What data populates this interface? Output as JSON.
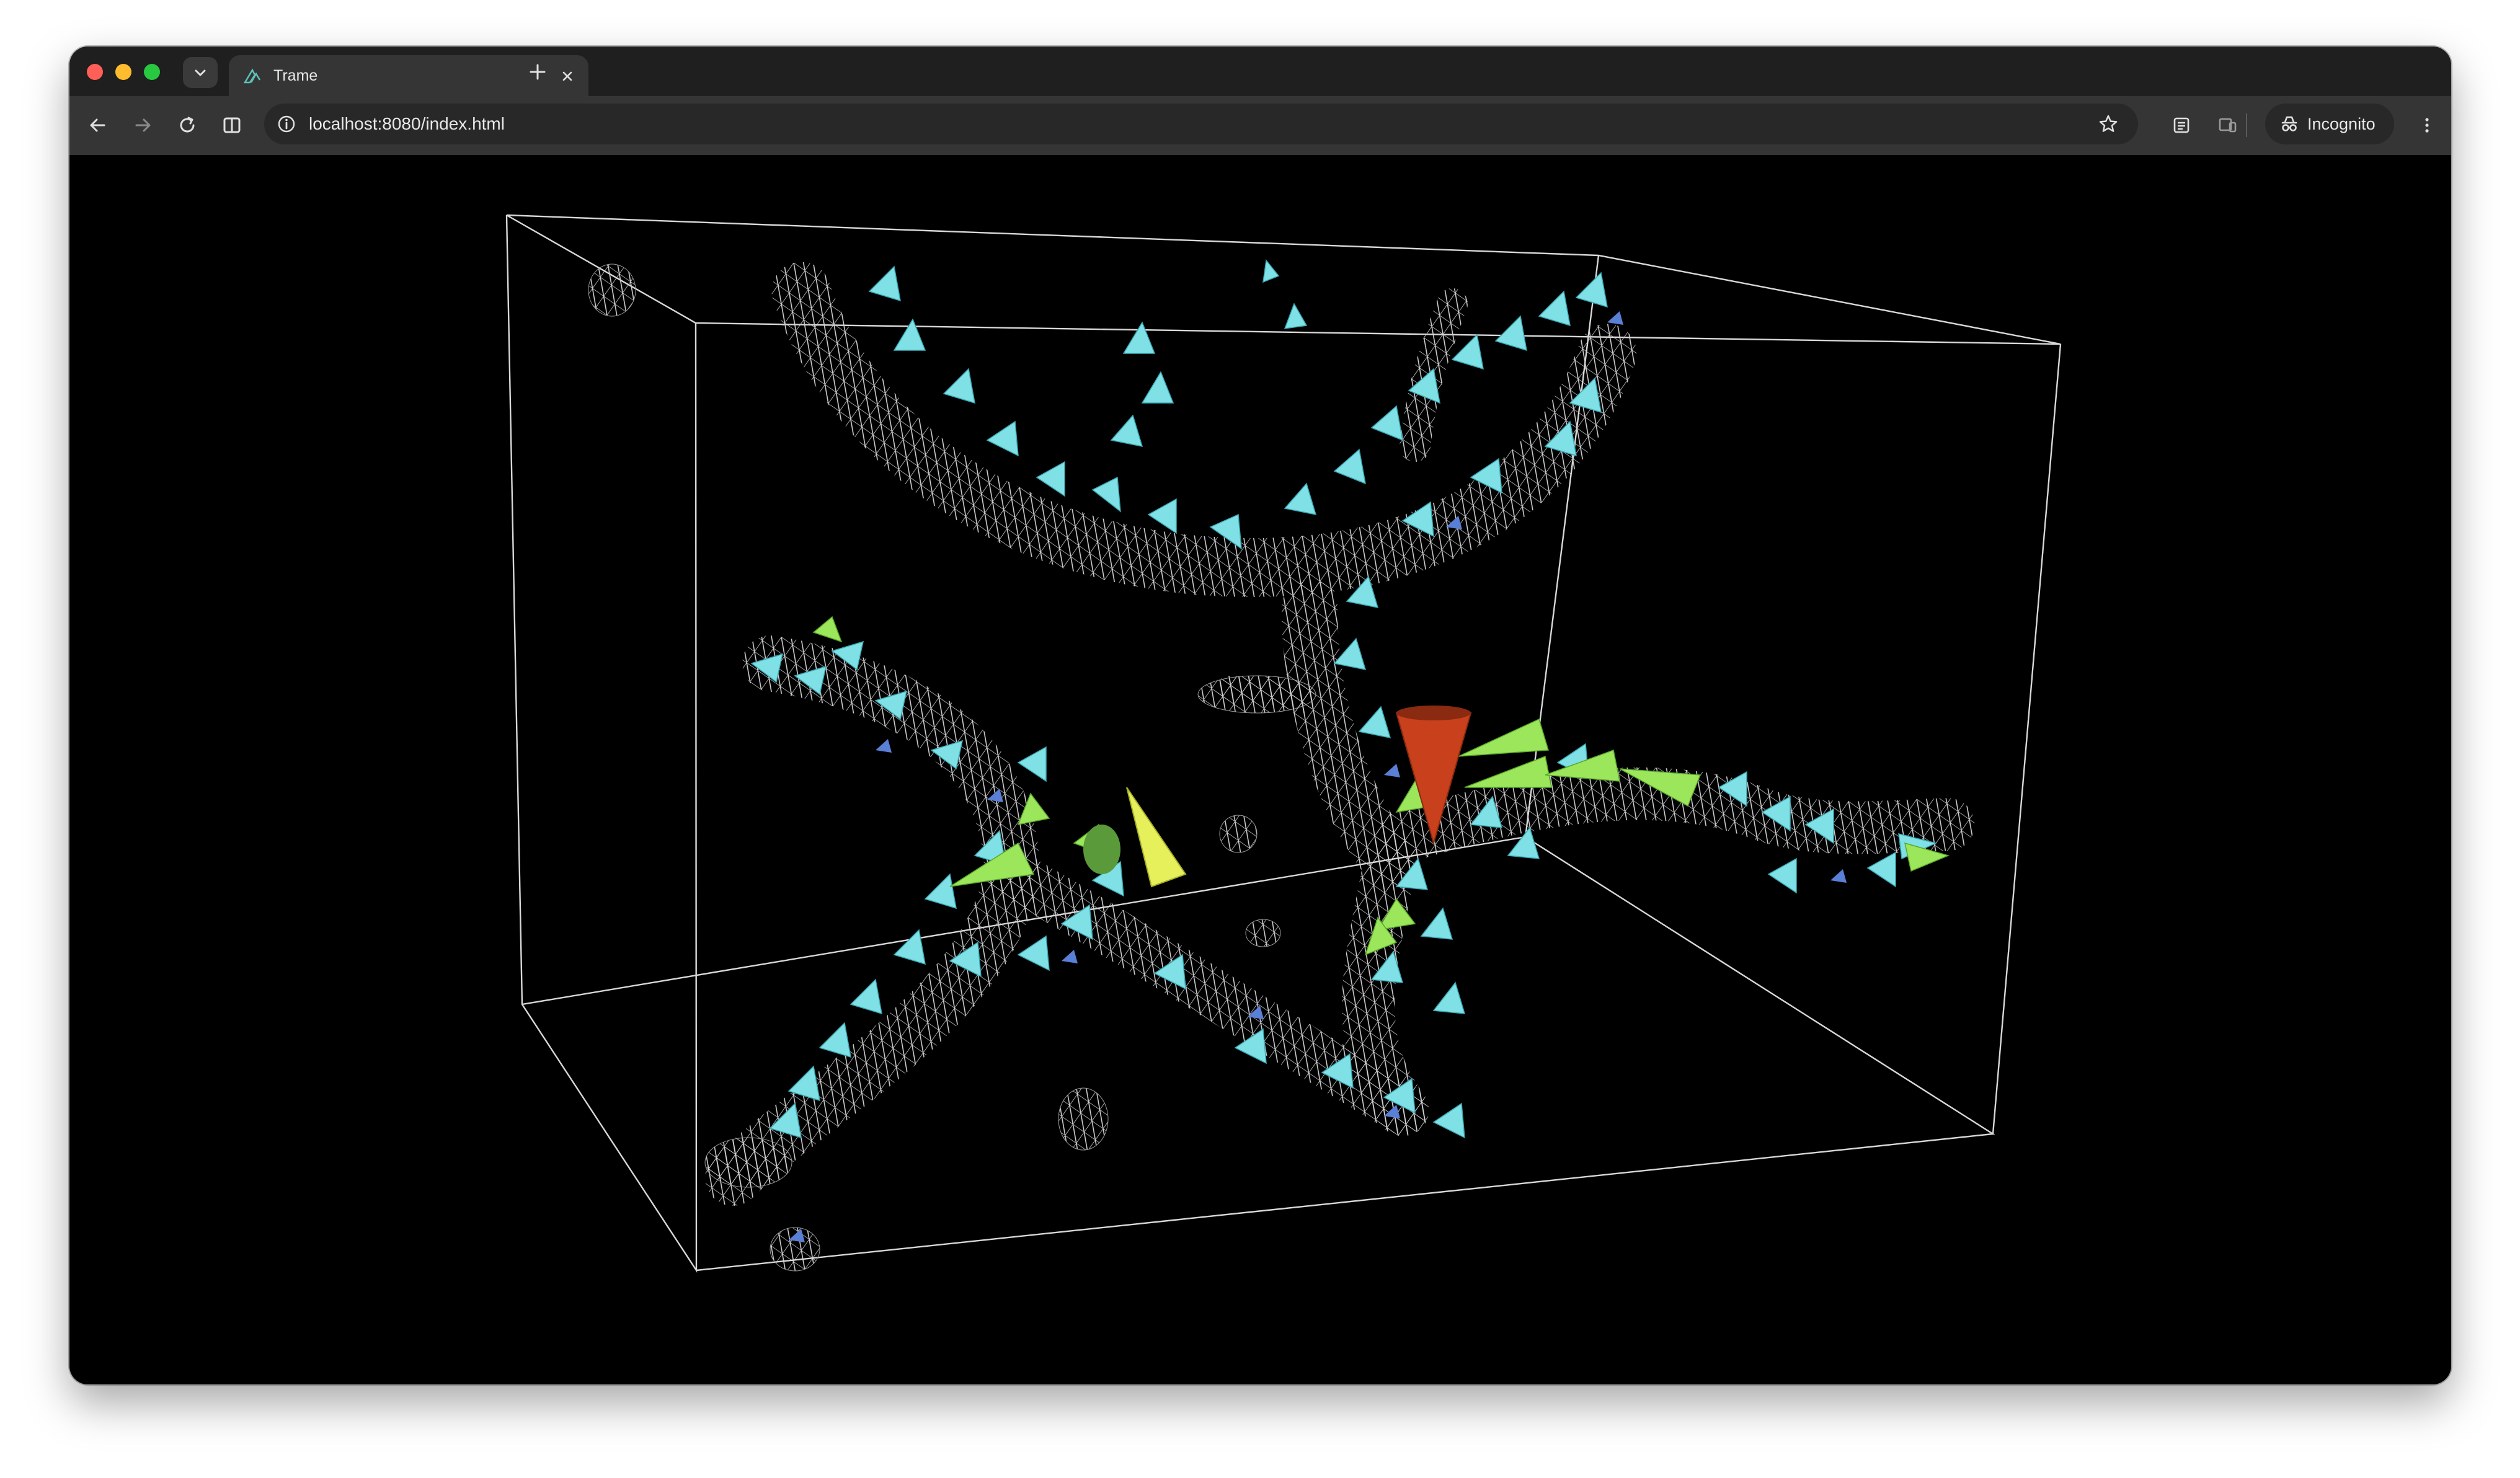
{
  "browser": {
    "tab": {
      "title": "Trame",
      "icon": "trame-logo-icon"
    },
    "address": {
      "url": "localhost:8080/index.html"
    },
    "profile": {
      "label": "Incognito"
    }
  },
  "icons": {
    "back": "arrow-left-icon",
    "forward": "arrow-right-icon",
    "reload": "reload-icon",
    "split": "split-view-icon",
    "info": "info-icon",
    "star": "star-icon",
    "reading": "reading-list-icon",
    "cast": "cast-icon",
    "menu": "kebab-menu-icon"
  },
  "colors": {
    "background": "#000000",
    "wireframe": "#c8c8c8",
    "glyph_cyan": "#7fe0e6",
    "glyph_green": "#9be65a",
    "glyph_yellow": "#e6f05a",
    "glyph_red": "#c8401c",
    "glyph_blue": "#5a7fd6"
  }
}
